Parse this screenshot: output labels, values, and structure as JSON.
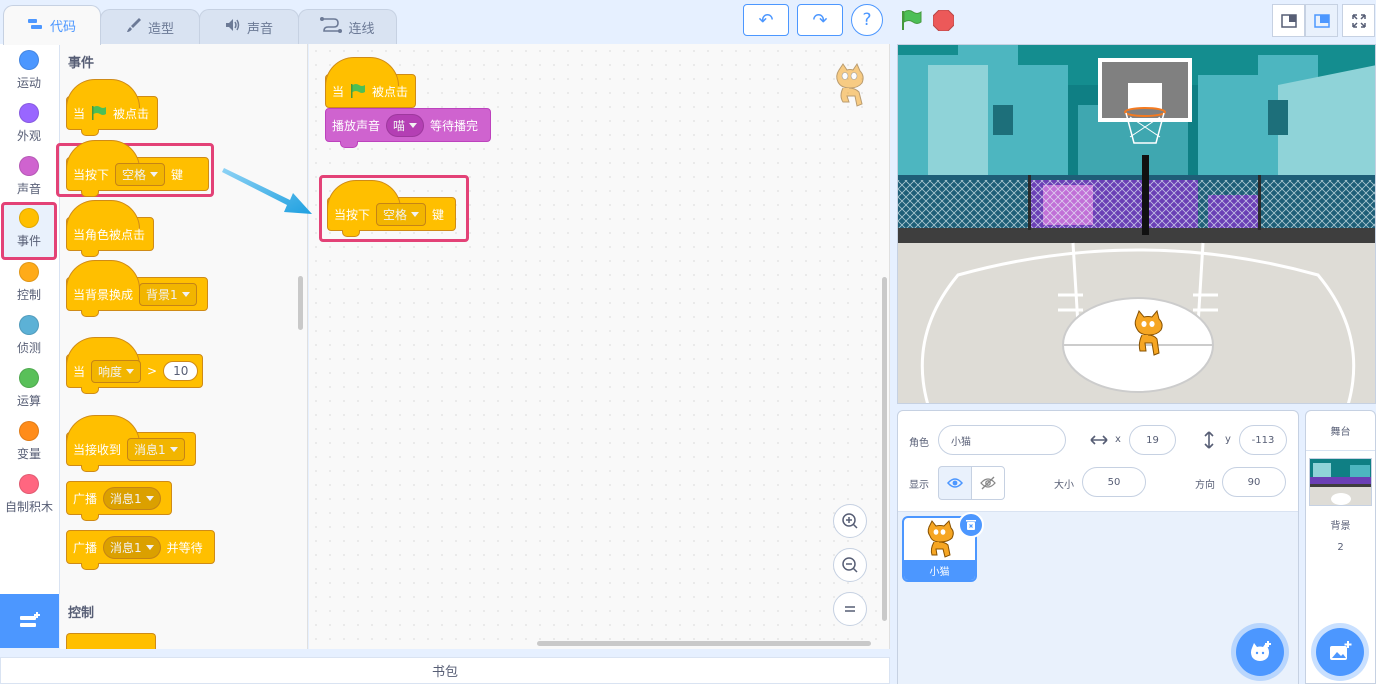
{
  "tabs": [
    {
      "label": "代码",
      "icon": "code-icon"
    },
    {
      "label": "造型",
      "icon": "brush-icon"
    },
    {
      "label": "声音",
      "icon": "speaker-icon"
    },
    {
      "label": "连线",
      "icon": "connect-icon"
    }
  ],
  "categories": [
    {
      "label": "运动",
      "color": "#4c97ff"
    },
    {
      "label": "外观",
      "color": "#9966ff"
    },
    {
      "label": "声音",
      "color": "#cf63cf"
    },
    {
      "label": "事件",
      "color": "#ffbf00"
    },
    {
      "label": "控制",
      "color": "#ffab19"
    },
    {
      "label": "侦测",
      "color": "#5cb1d6"
    },
    {
      "label": "运算",
      "color": "#59c059"
    },
    {
      "label": "变量",
      "color": "#ff8c1a"
    },
    {
      "label": "自制积木",
      "color": "#ff6680"
    }
  ],
  "palette": {
    "events_title": "事件",
    "control_title": "控制",
    "when_flag": {
      "prefix": "当",
      "suffix": "被点击"
    },
    "when_key": {
      "prefix": "当按下",
      "key": "空格",
      "suffix": "键"
    },
    "when_sprite_clicked": "当角色被点击",
    "when_backdrop": {
      "prefix": "当背景换成",
      "value": "背景1"
    },
    "when_greater": {
      "prefix": "当",
      "sensor": "响度",
      "op": ">",
      "value": "10"
    },
    "when_receive": {
      "prefix": "当接收到",
      "value": "消息1"
    },
    "broadcast": {
      "prefix": "广播",
      "value": "消息1"
    },
    "broadcast_wait": {
      "prefix": "广播",
      "value": "消息1",
      "suffix": "并等待"
    }
  },
  "code": {
    "when_flag": {
      "prefix": "当",
      "suffix": "被点击"
    },
    "play_sound": {
      "prefix": "播放声音",
      "value": "喵",
      "suffix": "等待播完"
    },
    "when_key": {
      "prefix": "当按下",
      "key": "空格",
      "suffix": "键"
    }
  },
  "backpack_label": "书包",
  "sprite_info": {
    "sprite_label": "角色",
    "sprite_name": "小猫",
    "x_label": "x",
    "x_value": "19",
    "y_label": "y",
    "y_value": "-113",
    "show_label": "显示",
    "size_label": "大小",
    "size_value": "50",
    "direction_label": "方向",
    "direction_value": "90"
  },
  "sprites": [
    {
      "name": "小猫"
    }
  ],
  "stage_pane": {
    "title": "舞台",
    "backdrop_label": "背景",
    "backdrop_count": "2"
  },
  "colors": {
    "accent": "#4c97ff",
    "highlight": "#e34277",
    "events": "#ffbf00",
    "sound": "#cf63cf"
  }
}
